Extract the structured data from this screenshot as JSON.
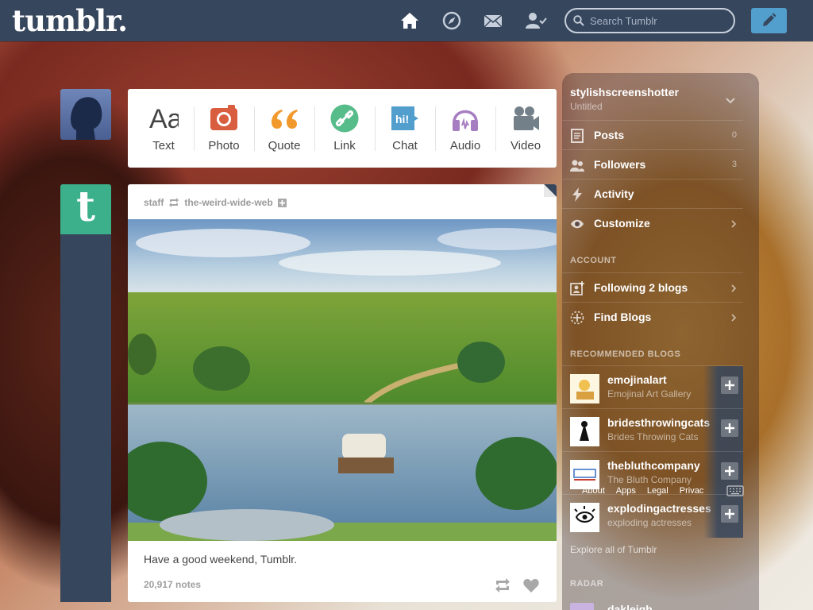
{
  "header": {
    "logo": "tumblr.",
    "search": {
      "placeholder": "Search Tumblr",
      "value": ""
    },
    "nav_icons": [
      "home-icon",
      "explore-compass-icon",
      "inbox-envelope-icon",
      "account-person-icon"
    ],
    "compose_icon": "pencil-icon",
    "accent_color": "#36465d",
    "compose_color": "#529ecc"
  },
  "post_types": [
    {
      "label": "Text",
      "icon": "text-aa-icon",
      "color": "#444444"
    },
    {
      "label": "Photo",
      "icon": "camera-icon",
      "color": "#d95e40"
    },
    {
      "label": "Quote",
      "icon": "quote-icon",
      "color": "#f2992e"
    },
    {
      "label": "Link",
      "icon": "link-icon",
      "color": "#56bc8a"
    },
    {
      "label": "Chat",
      "icon": "chat-bubble-icon",
      "color": "#529ecc"
    },
    {
      "label": "Audio",
      "icon": "headphones-icon",
      "color": "#a77dc2"
    },
    {
      "label": "Video",
      "icon": "video-camera-icon",
      "color": "#748089"
    }
  ],
  "post": {
    "author": "staff",
    "reblogged_from": "the-weird-wide-web",
    "caption": "Have a good weekend, Tumblr.",
    "notes": "20,917 notes"
  },
  "sidebar": {
    "blog_name": "stylishscreenshotter",
    "blog_title": "Untitled",
    "stats": [
      {
        "label": "Posts",
        "count": "0",
        "icon": "posts-icon"
      },
      {
        "label": "Followers",
        "count": "3",
        "icon": "followers-icon"
      },
      {
        "label": "Activity",
        "count": "",
        "icon": "activity-bolt-icon"
      },
      {
        "label": "Customize",
        "count": "",
        "icon": "customize-eye-icon"
      }
    ],
    "account_heading": "ACCOUNT",
    "account_items": [
      {
        "label": "Following 2 blogs",
        "icon": "following-icon"
      },
      {
        "label": "Find Blogs",
        "icon": "find-blogs-icon"
      }
    ],
    "recommended_heading": "RECOMMENDED BLOGS",
    "recommended": [
      {
        "name": "emojinalart",
        "title": "Emojinal Art Gallery"
      },
      {
        "name": "bridesthrowingcats",
        "title": "Brides Throwing Cats"
      },
      {
        "name": "thebluthcompany",
        "title": "The Bluth Company"
      },
      {
        "name": "explodingactresses",
        "title": "exploding actresses"
      }
    ],
    "footer_links": [
      "About",
      "Apps",
      "Legal",
      "Privac"
    ],
    "explore_link": "Explore all of Tumblr",
    "radar_heading": "RADAR",
    "radar_item": "dakleigh"
  }
}
